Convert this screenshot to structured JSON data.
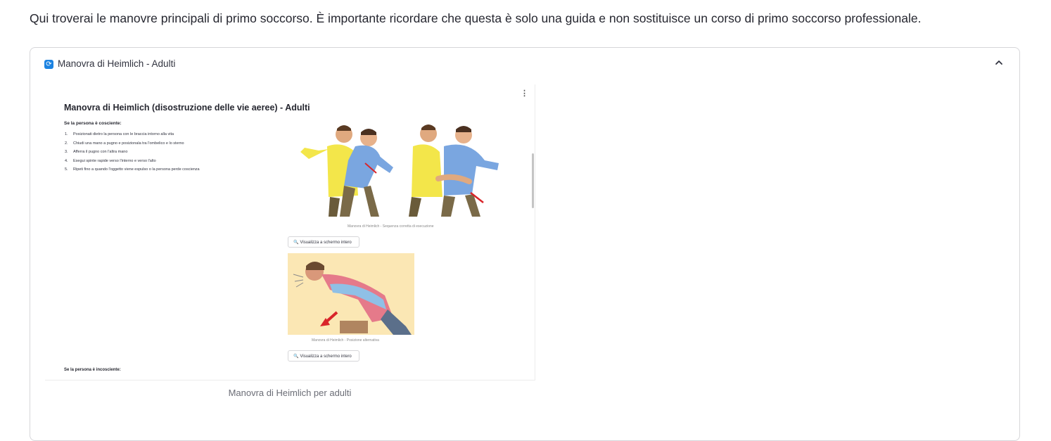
{
  "intro_text": "Qui troverai le manovre principali di primo soccorso. È importante ricordare che questa è solo una guida e non sostituisce un corso di primo soccorso professionale.",
  "expander": {
    "title": "Manovra di Heimlich - Adulti",
    "icon": "refresh-square-icon",
    "chevron": "chevron-up-icon"
  },
  "document": {
    "menu_glyph": "⋮",
    "title": "Manovra di Heimlich (disostruzione delle vie aeree) - Adulti",
    "conscious_heading": "Se la persona è cosciente:",
    "steps": [
      {
        "num": "1.",
        "text": "Posizionati dietro la persona con le braccia intorno alla vita"
      },
      {
        "num": "2.",
        "text": "Chiudi una mano a pugno e posizionala tra l'ombelico e lo sterno"
      },
      {
        "num": "3.",
        "text": "Afferra il pugno con l'altra mano"
      },
      {
        "num": "4.",
        "text": "Esegui spinte rapide verso l'interno e verso l'alto"
      },
      {
        "num": "5.",
        "text": "Ripeti fino a quando l'oggetto viene espulso o la persona perde coscienza"
      }
    ],
    "image1_caption": "Manovra di Heimlich - Sequenza corretta di esecuzione",
    "fullscreen_button_1": "Visualizza a schermo intero",
    "image2_caption": "Manovra di Heimlich - Posizione alternativa",
    "fullscreen_button_2": "Visualizza a schermo intero",
    "unconscious_heading": "Se la persona è incosciente:"
  },
  "caption": "Manovra di Heimlich per adulti",
  "colors": {
    "accent": "#1c83e1",
    "yellow_shirt": "#f3e64a",
    "blue_shirt": "#7aa6e0",
    "arrow_red": "#d9252a",
    "image2_bg": "#fbe7b4"
  }
}
